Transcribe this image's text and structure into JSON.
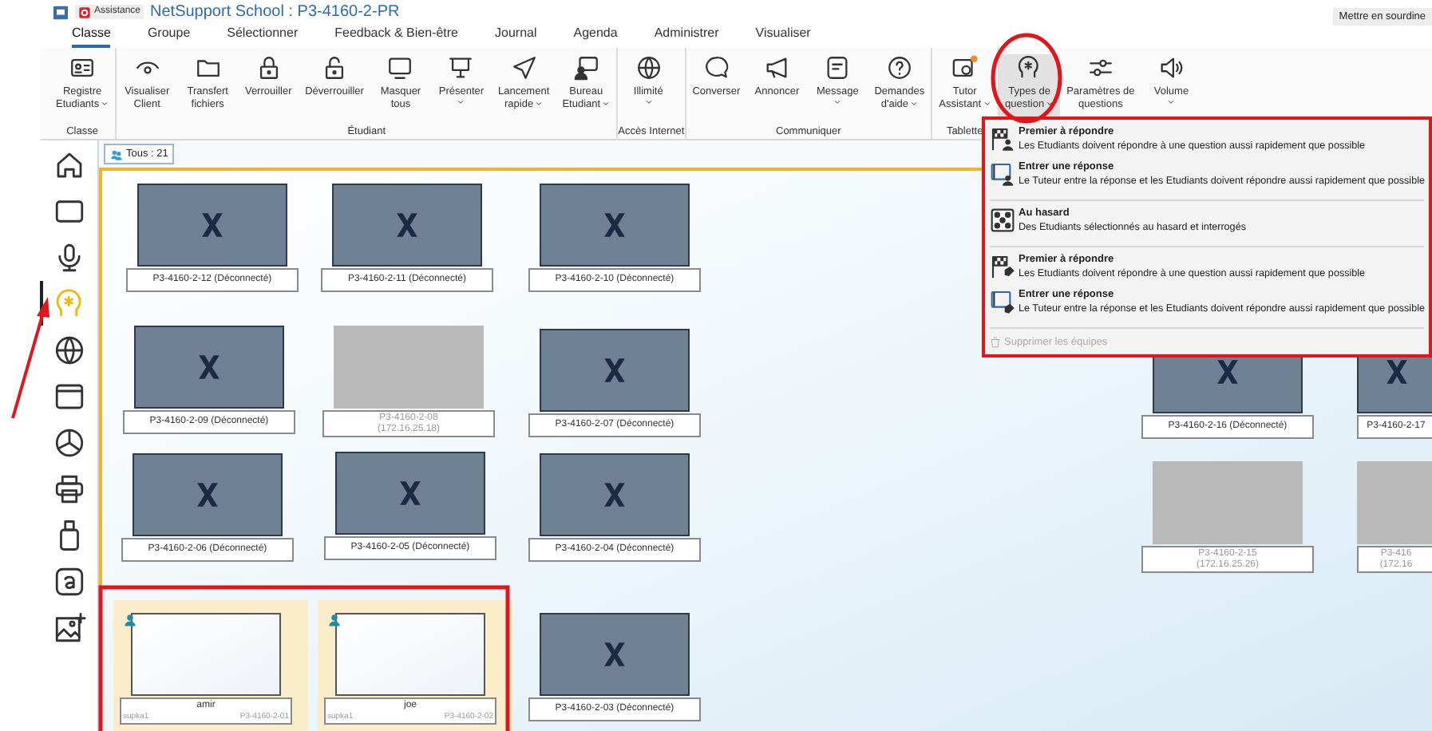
{
  "window": {
    "badge": "Assistance",
    "title": "NetSupport School : P3-4160-2-PR",
    "mute_button": "Mettre en sourdine"
  },
  "menu_tabs": [
    {
      "label": "Classe",
      "selected": true
    },
    {
      "label": "Groupe",
      "selected": false
    },
    {
      "label": "Sélectionner",
      "selected": false
    },
    {
      "label": "Feedback & Bien-être",
      "selected": false
    },
    {
      "label": "Journal",
      "selected": false
    },
    {
      "label": "Agenda",
      "selected": false
    },
    {
      "label": "Administrer",
      "selected": false
    },
    {
      "label": "Visualiser",
      "selected": false
    }
  ],
  "ribbon": {
    "groups": [
      {
        "label": "Classe",
        "buttons": [
          {
            "lines": [
              "Registre",
              "Etudiants"
            ],
            "dropdown": true,
            "selected": false
          }
        ]
      },
      {
        "label": "Étudiant",
        "buttons": [
          {
            "lines": [
              "Visualiser",
              "Client"
            ],
            "dropdown": false,
            "selected": false
          },
          {
            "lines": [
              "Transfert",
              "fichiers"
            ],
            "dropdown": false,
            "selected": false
          },
          {
            "lines": [
              "Verrouiller"
            ],
            "dropdown": false,
            "selected": false
          },
          {
            "lines": [
              "Déverrouiller"
            ],
            "dropdown": false,
            "selected": false
          },
          {
            "lines": [
              "Masquer",
              "tous"
            ],
            "dropdown": false,
            "selected": false
          },
          {
            "lines": [
              "Présenter"
            ],
            "dropdown": true,
            "selected": false
          },
          {
            "lines": [
              "Lancement",
              "rapide"
            ],
            "dropdown": true,
            "selected": false
          },
          {
            "lines": [
              "Bureau",
              "Etudiant"
            ],
            "dropdown": true,
            "selected": false
          }
        ]
      },
      {
        "label": "Accès Internet",
        "buttons": [
          {
            "lines": [
              "Illimité"
            ],
            "dropdown": true,
            "selected": false
          }
        ]
      },
      {
        "label": "Communiquer",
        "buttons": [
          {
            "lines": [
              "Converser"
            ],
            "dropdown": false,
            "selected": false
          },
          {
            "lines": [
              "Annoncer"
            ],
            "dropdown": false,
            "selected": false
          },
          {
            "lines": [
              "Message"
            ],
            "dropdown": true,
            "selected": false
          },
          {
            "lines": [
              "Demandes",
              "d'aide"
            ],
            "dropdown": true,
            "selected": false
          }
        ]
      },
      {
        "label": "Tablette",
        "buttons": [
          {
            "lines": [
              "Tutor",
              "Assistant"
            ],
            "dropdown": true,
            "selected": false
          }
        ]
      },
      {
        "buttons": [
          {
            "lines": [
              "Types de",
              "question"
            ],
            "dropdown": true,
            "selected": true
          },
          {
            "lines": [
              "Paramètres de",
              "questions"
            ],
            "dropdown": false,
            "selected": false
          },
          {
            "lines": [
              "Volume"
            ],
            "dropdown": true,
            "selected": false
          }
        ]
      }
    ]
  },
  "sidebar": {
    "items": [
      {
        "selected": false
      },
      {
        "selected": false
      },
      {
        "selected": false
      },
      {
        "selected": true
      },
      {
        "selected": false
      },
      {
        "selected": false
      },
      {
        "selected": false
      },
      {
        "selected": false
      },
      {
        "selected": false
      },
      {
        "selected": false
      },
      {
        "selected": false
      }
    ]
  },
  "group_tab": {
    "label": "Tous : 21"
  },
  "students": [
    {
      "kind": "disconnected",
      "lines": [
        "P3-4160-2-12 (Déconnecté)"
      ]
    },
    {
      "kind": "disconnected",
      "lines": [
        "P3-4160-2-11 (Déconnecté)"
      ]
    },
    {
      "kind": "disconnected",
      "lines": [
        "P3-4160-2-10 (Déconnecté)"
      ]
    },
    {
      "kind": "disconnected",
      "lines": [
        "P3-4160-2-09 (Déconnecté)"
      ]
    },
    {
      "kind": "offline",
      "lines": [
        "P3-4160-2-08",
        "(172.16.25.18)"
      ]
    },
    {
      "kind": "disconnected",
      "lines": [
        "P3-4160-2-07 (Déconnecté)"
      ]
    },
    {
      "kind": "disconnected",
      "lines": [
        "P3-4160-2-16 (Déconnecté)"
      ]
    },
    {
      "kind": "disconnected",
      "lines": [
        "P3-4160-2-17"
      ]
    },
    {
      "kind": "disconnected",
      "lines": [
        "P3-4160-2-06 (Déconnecté)"
      ]
    },
    {
      "kind": "disconnected",
      "lines": [
        "P3-4160-2-05 (Déconnecté)"
      ]
    },
    {
      "kind": "disconnected",
      "lines": [
        "P3-4160-2-04 (Déconnecté)"
      ]
    },
    {
      "kind": "offline",
      "lines": [
        "P3-4160-2-15",
        "(172.16.25.26)"
      ]
    },
    {
      "kind": "offline",
      "lines": [
        "P3-416",
        "(172.16"
      ]
    },
    {
      "kind": "connected",
      "name": "amir",
      "user": "supka1",
      "computer": "P3-4160-2-01"
    },
    {
      "kind": "connected",
      "name": "joe",
      "user": "supka1",
      "computer": "P3-4160-2-02"
    },
    {
      "kind": "disconnected",
      "lines": [
        "P3-4160-2-03 (Déconnecté)"
      ]
    }
  ],
  "question_menu": {
    "groups": [
      [
        {
          "kind": "flag-person",
          "title": "Premier à répondre",
          "description": "Les Etudiants doivent répondre à une question aussi rapidement que possible"
        },
        {
          "kind": "screen-person",
          "title": "Entrer une réponse",
          "description": "Le Tuteur entre la réponse et les Etudiants doivent répondre aussi rapidement que possible"
        }
      ],
      [
        {
          "kind": "dice",
          "title": "Au hasard",
          "description": "Des Etudiants sélectionnés au hasard et interrogés"
        }
      ],
      [
        {
          "kind": "flag-tag",
          "title": "Premier à répondre",
          "description": "Les Etudiants doivent répondre à une question aussi rapidement que possible"
        },
        {
          "kind": "screen-tag",
          "title": "Entrer une réponse",
          "description": "Le Tuteur entre la réponse et les Etudiants doivent répondre aussi rapidement que possible"
        }
      ]
    ],
    "footer": {
      "label": "Supprimer les équipes",
      "disabled": true
    }
  }
}
